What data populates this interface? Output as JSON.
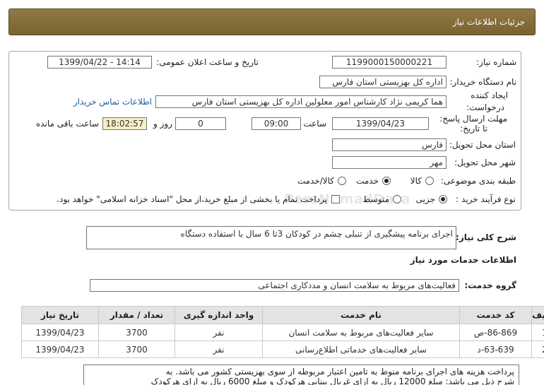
{
  "page": {
    "title": "جزئیات اطلاعات نیاز"
  },
  "colors": {
    "header_bg_top": "#927a48",
    "header_bg_bottom": "#79622f",
    "remaining_bg": "#f6efc4",
    "link": "#1f5fa6"
  },
  "form": {
    "need_number": {
      "label": "شماره نیاز:",
      "value": "1199000150000221"
    },
    "announce": {
      "label": "تاریخ و ساعت اعلان عمومی:",
      "value": "1399/04/22 - 14:14"
    },
    "buyer": {
      "label": "نام دستگاه خریدار:",
      "value": "اداره کل بهزیستی استان فارس"
    },
    "creator": {
      "label_line1": "ایجاد کننده",
      "label_line2": "درخواست:",
      "value": "هما کریمی نژاد کارشناس امور معلولین اداره کل بهزیستی استان فارس",
      "contact_link": "اطلاعات تماس خریدار"
    },
    "deadline": {
      "label_line1": "مهلت ارسال پاسخ:",
      "label_line2": "تا تاریخ:",
      "date": "1399/04/23",
      "time_label": "ساعت",
      "time": "09:00",
      "days": "0",
      "days_label": "روز و",
      "remaining": "18:02:57",
      "remaining_label": "ساعت باقی مانده"
    },
    "province": {
      "label": "استان محل تحویل:",
      "value": "فارس"
    },
    "city": {
      "label": "شهر محل تحویل:",
      "value": "مهر"
    },
    "category": {
      "label": "طبقه بندی موضوعی:",
      "options": [
        {
          "label": "کالا",
          "selected": false
        },
        {
          "label": "خدمت",
          "selected": true
        },
        {
          "label": "کالا/خدمت",
          "selected": false
        }
      ]
    },
    "process": {
      "label": "نوع فرآیند خرید :",
      "options": [
        {
          "label": "جزیی",
          "selected": true
        },
        {
          "label": "متوسط",
          "selected": false
        }
      ],
      "treasury": {
        "checked": false,
        "label": "پرداخت تمام یا بخشی از مبلغ خرید،از محل \"اسناد خزانه اسلامی\" خواهد بود."
      }
    }
  },
  "description": {
    "label": "شرح کلی نیاز:",
    "value": "اجرای برنامه پیشگیری از تنبلی چشم در کودکان 3تا 6 سال با استفاده دستگاه"
  },
  "services": {
    "title": "اطلاعات خدمات مورد نیاز",
    "group_label": "گروه خدمت:",
    "group_value": "فعالیت‌های مربوط به سلامت انسان و مددکاری اجتماعی",
    "headers": {
      "row": "ردیف",
      "code": "کد خدمت",
      "name": "نام خدمت",
      "unit": "واحد اندازه گیری",
      "qty": "تعداد / مقدار",
      "date": "تاریخ نیاز"
    },
    "rows": [
      {
        "row": "1",
        "code": "ص-86-869",
        "name": "سایر فعالیت‌های مربوط به سلامت انسان",
        "unit": "نفر",
        "qty": "3700",
        "date": "1399/04/23"
      },
      {
        "row": "2",
        "code": "د-63-639",
        "name": "سایر فعالیت‌های خدماتی اطلاع‌رسانی",
        "unit": "نفر",
        "qty": "3700",
        "date": "1399/04/23"
      }
    ]
  },
  "notes": {
    "lines": [
      "پرداخت هزینه های اجرای برنامه منوط به تامین اعتبار مربوطه از سوی بهزیستی کشور می باشد. به",
      "شرح ذیل می باشد: مبلغ 12000 ریال به ازای غربال بینایی هرکودک و مبلغ 6000 ریال به ازای هرکودک"
    ]
  },
  "watermark": "ParsNamadData"
}
